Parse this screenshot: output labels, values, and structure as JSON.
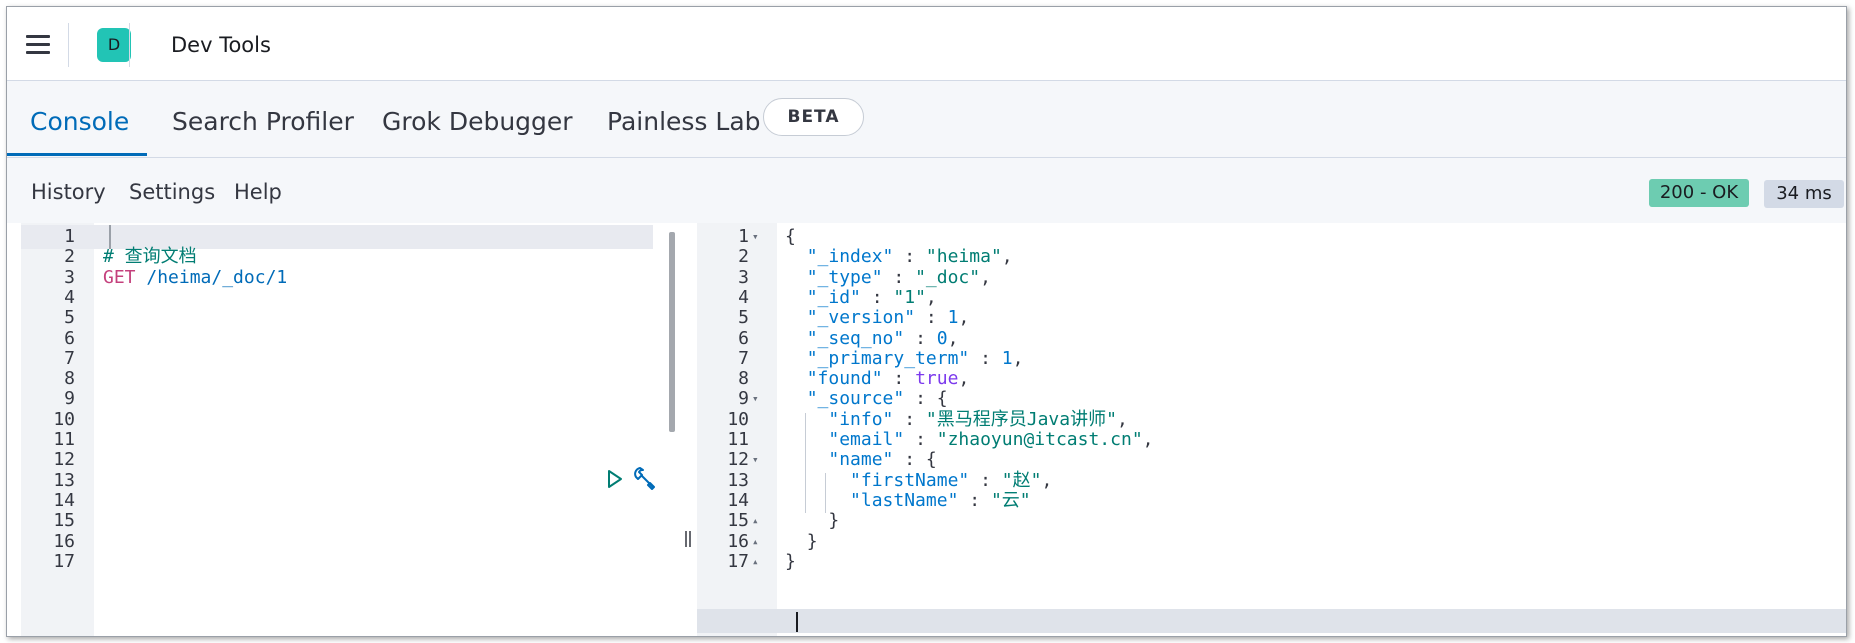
{
  "header": {
    "menu_icon": "hamburger-menu-icon",
    "avatar_letter": "D",
    "avatar_color": "#22c4b5",
    "title": "Dev Tools"
  },
  "tabs": [
    {
      "label": "Console",
      "active": true
    },
    {
      "label": "Search Profiler",
      "active": false
    },
    {
      "label": "Grok Debugger",
      "active": false
    },
    {
      "label": "Painless Lab",
      "active": false,
      "badge": "BETA"
    }
  ],
  "toolbar": {
    "history": "History",
    "settings": "Settings",
    "help": "Help",
    "status": "200 - OK",
    "status_color": "#6dccb1",
    "time": "34 ms"
  },
  "request_editor": {
    "line_numbers": [
      "1",
      "2",
      "3",
      "4",
      "5",
      "6",
      "7",
      "8",
      "9",
      "10",
      "11",
      "12",
      "13",
      "14",
      "15",
      "16",
      "17"
    ],
    "comment": "# 查询文档",
    "method": "GET",
    "path": "/heima/_doc/1",
    "run_icon": "play-icon",
    "settings_icon": "wrench-icon"
  },
  "response_editor": {
    "line_numbers": [
      "1",
      "2",
      "3",
      "4",
      "5",
      "6",
      "7",
      "8",
      "9",
      "10",
      "11",
      "12",
      "13",
      "14",
      "15",
      "16",
      "17"
    ],
    "lines": {
      "l1": "{",
      "l2_key": "\"_index\"",
      "l2_val": "\"heima\"",
      "l3_key": "\"_type\"",
      "l3_val": "\"_doc\"",
      "l4_key": "\"_id\"",
      "l4_val": "\"1\"",
      "l5_key": "\"_version\"",
      "l5_val": "1",
      "l6_key": "\"_seq_no\"",
      "l6_val": "0",
      "l7_key": "\"_primary_term\"",
      "l7_val": "1",
      "l8_key": "\"found\"",
      "l8_val": "true",
      "l9_key": "\"_source\"",
      "l10_key": "\"info\"",
      "l10_val": "\"黑马程序员Java讲师\"",
      "l11_key": "\"email\"",
      "l11_val": "\"zhaoyun@itcast.cn\"",
      "l12_key": "\"name\"",
      "l13_key": "\"firstName\"",
      "l13_val": "\"赵\"",
      "l14_key": "\"lastName\"",
      "l14_val": "\"云\"",
      "l15": "}",
      "l16": "}",
      "l17": "}"
    }
  }
}
